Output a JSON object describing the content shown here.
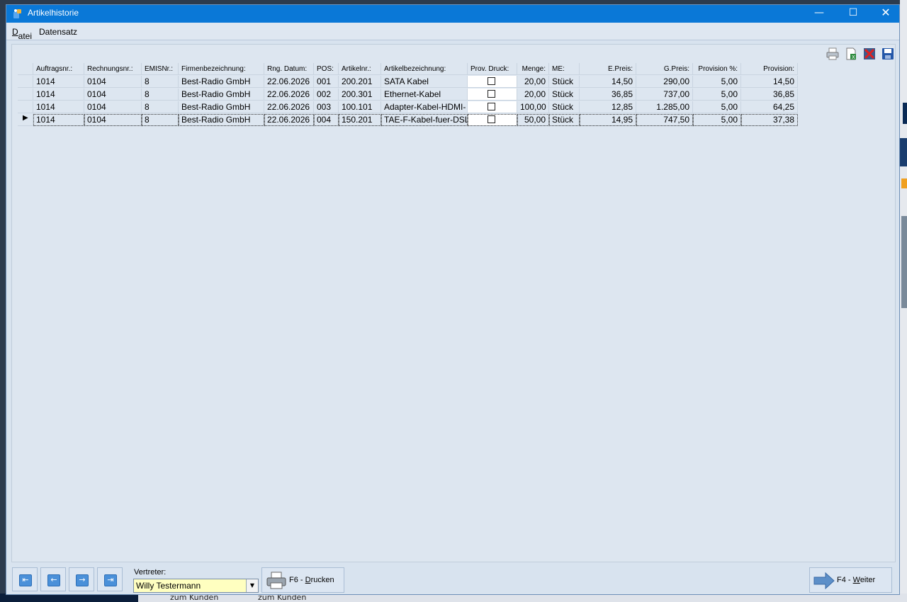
{
  "window": {
    "title": "Artikelhistorie"
  },
  "menu": [
    "Datei",
    "Datensatz"
  ],
  "columns": [
    {
      "label": "Auftragsnr.:",
      "w": 72,
      "align": "l"
    },
    {
      "label": "Rechnungsnr.:",
      "w": 81,
      "align": "l"
    },
    {
      "label": "EMISNr.:",
      "w": 52,
      "align": "l"
    },
    {
      "label": "Firmenbezeichnung:",
      "w": 121,
      "align": "l"
    },
    {
      "label": "Rng. Datum:",
      "w": 70,
      "align": "l"
    },
    {
      "label": "POS:",
      "w": 35,
      "align": "l"
    },
    {
      "label": "Artikelnr.:",
      "w": 60,
      "align": "l"
    },
    {
      "label": "Artikelbezeichnung:",
      "w": 122,
      "align": "l"
    },
    {
      "label": "Prov. Druck:",
      "w": 70,
      "align": "c"
    },
    {
      "label": "Menge:",
      "w": 45,
      "align": "r"
    },
    {
      "label": "ME:",
      "w": 43,
      "align": "l"
    },
    {
      "label": "E.Preis:",
      "w": 80,
      "align": "r"
    },
    {
      "label": "G.Preis:",
      "w": 80,
      "align": "r"
    },
    {
      "label": "Provision %:",
      "w": 68,
      "align": "r"
    },
    {
      "label": "Provision:",
      "w": 80,
      "align": "r"
    }
  ],
  "rows": [
    [
      "1014",
      "0104",
      "8",
      "Best-Radio GmbH",
      "22.06.2026",
      "001",
      "200.201",
      "SATA Kabel",
      "",
      "20,00",
      "Stück",
      "14,50",
      "290,00",
      "5,00",
      "14,50"
    ],
    [
      "1014",
      "0104",
      "8",
      "Best-Radio GmbH",
      "22.06.2026",
      "002",
      "200.301",
      "Ethernet-Kabel",
      "",
      "20,00",
      "Stück",
      "36,85",
      "737,00",
      "5,00",
      "36,85"
    ],
    [
      "1014",
      "0104",
      "8",
      "Best-Radio GmbH",
      "22.06.2026",
      "003",
      "100.101",
      "Adapter-Kabel-HDMI-",
      "",
      "100,00",
      "Stück",
      "12,85",
      "1.285,00",
      "5,00",
      "64,25"
    ],
    [
      "1014",
      "0104",
      "8",
      "Best-Radio GmbH",
      "22.06.2026",
      "004",
      "150.201",
      "TAE-F-Kabel-fuer-DSL-",
      "",
      "50,00",
      "Stück",
      "14,95",
      "747,50",
      "5,00",
      "37,38"
    ]
  ],
  "current_row": 3,
  "bottom": {
    "vertreter_label": "Vertreter:",
    "vertreter_value": "Willy Testermann",
    "print_prefix": "F6 - ",
    "print_key": "D",
    "print_rest": "rucken",
    "next_prefix": "F4 - ",
    "next_key": "W",
    "next_rest": "eiter"
  },
  "background": {
    "taskbar_items": [
      "zum Kunden",
      "zum Kunden"
    ]
  },
  "colors": {
    "titlebar": "#0a78d7",
    "window_bg": "#d8e3ef",
    "combo_bg": "#ffffc0"
  }
}
